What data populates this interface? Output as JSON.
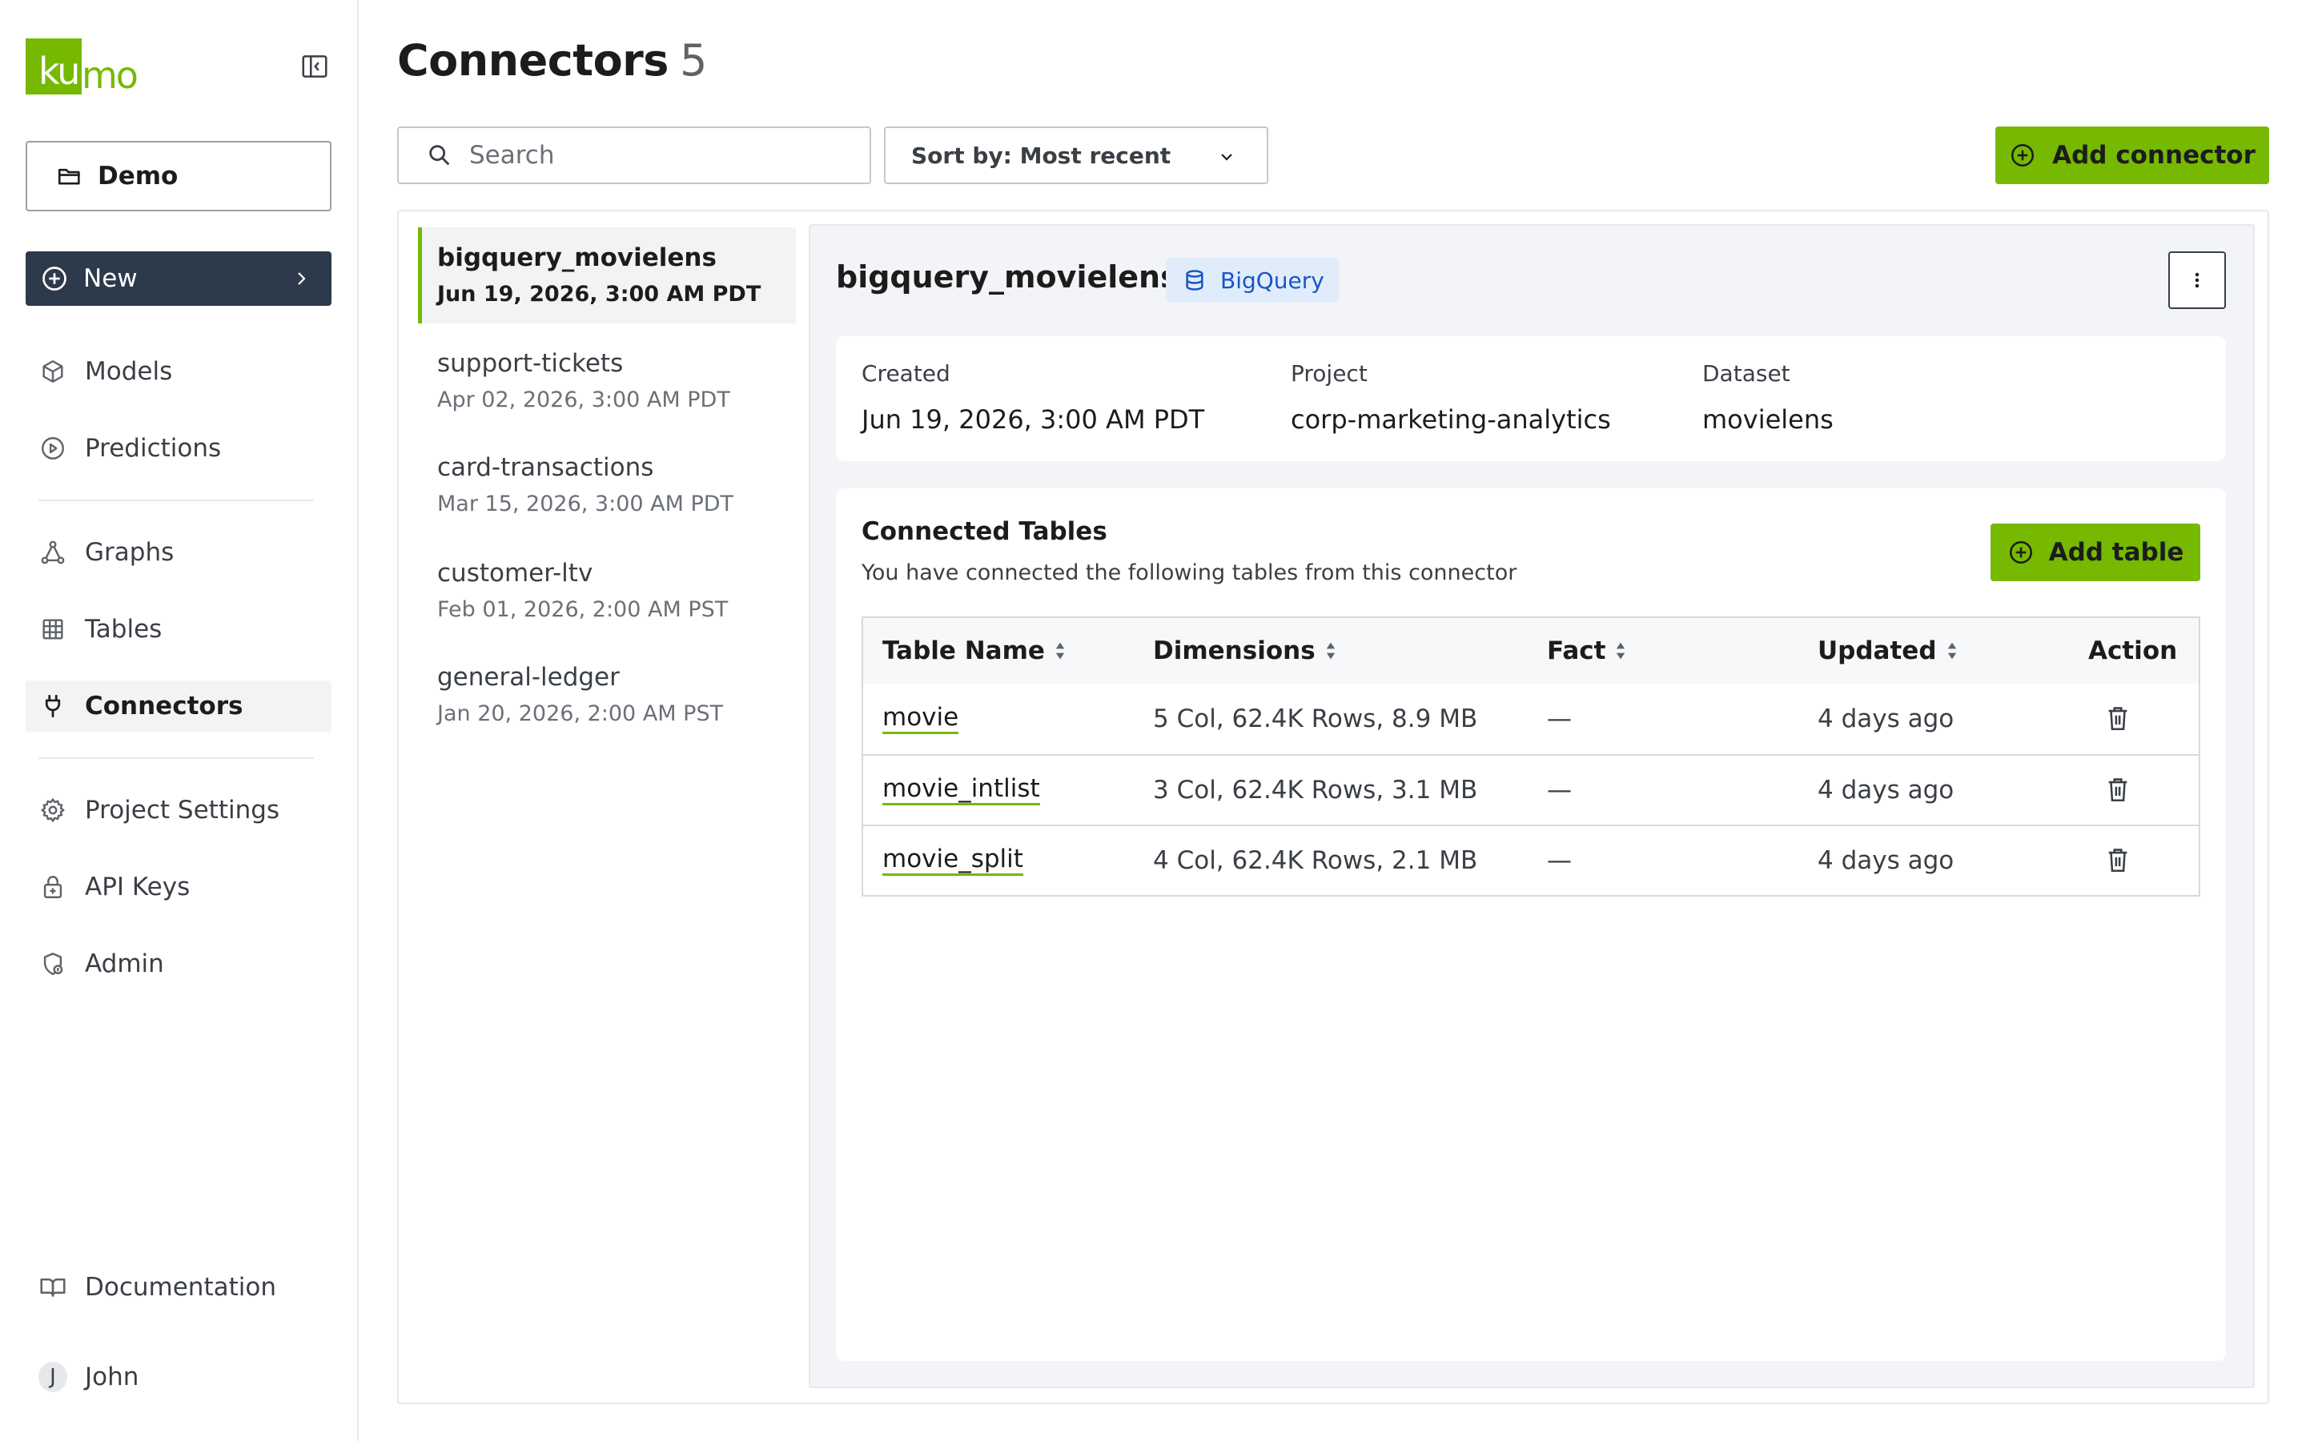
{
  "sidebar": {
    "logo": "kumo",
    "project_button": "Demo",
    "new_button": "New",
    "nav_primary": [
      {
        "label": "Models",
        "icon": "cube-icon"
      },
      {
        "label": "Predictions",
        "icon": "play-circle-icon"
      }
    ],
    "nav_data": [
      {
        "label": "Graphs",
        "icon": "graph-icon"
      },
      {
        "label": "Tables",
        "icon": "table-icon"
      },
      {
        "label": "Connectors",
        "icon": "plug-icon",
        "active": true
      }
    ],
    "nav_settings": [
      {
        "label": "Project Settings",
        "icon": "gear-icon"
      },
      {
        "label": "API Keys",
        "icon": "lock-icon"
      },
      {
        "label": "Admin",
        "icon": "admin-shield-icon"
      }
    ],
    "documentation": "Documentation",
    "user": {
      "initial": "J",
      "name": "John"
    }
  },
  "header": {
    "title": "Connectors",
    "count": "5",
    "search_placeholder": "Search",
    "sort_label": "Sort by: Most recent",
    "add_connector": "Add connector"
  },
  "connectors": [
    {
      "name": "bigquery_movielens",
      "date": "Jun 19, 2026, 3:00 AM PDT",
      "active": true
    },
    {
      "name": "support-tickets",
      "date": "Apr 02, 2026, 3:00 AM PDT"
    },
    {
      "name": "card-transactions",
      "date": "Mar 15, 2026, 3:00 AM PDT"
    },
    {
      "name": "customer-ltv",
      "date": "Feb 01, 2026, 2:00 AM PST"
    },
    {
      "name": "general-ledger",
      "date": "Jan 20, 2026, 2:00 AM PST"
    }
  ],
  "detail": {
    "name": "bigquery_movielens",
    "type_badge": "BigQuery",
    "meta": {
      "created_label": "Created",
      "created_value": "Jun 19, 2026, 3:00 AM PDT",
      "project_label": "Project",
      "project_value": "corp-marketing-analytics",
      "dataset_label": "Dataset",
      "dataset_value": "movielens"
    },
    "tables_title": "Connected Tables",
    "tables_subtitle": "You have connected the following tables from this connector",
    "add_table": "Add table",
    "columns": [
      "Table Name",
      "Dimensions",
      "Fact",
      "Updated",
      "Action"
    ],
    "rows": [
      {
        "name": "movie",
        "dimensions": "5 Col, 62.4K Rows, 8.9 MB",
        "fact": "—",
        "updated": "4 days ago"
      },
      {
        "name": "movie_intlist",
        "dimensions": "3 Col, 62.4K Rows, 3.1 MB",
        "fact": "—",
        "updated": "4 days ago"
      },
      {
        "name": "movie_split",
        "dimensions": "4 Col, 62.4K Rows, 2.1 MB",
        "fact": "—",
        "updated": "4 days ago"
      }
    ]
  },
  "colors": {
    "brand_green": "#76b900",
    "new_button_bg": "#2c3a4b",
    "badge_blue": "#1a56c4",
    "badge_bg": "#e1ecfb"
  }
}
